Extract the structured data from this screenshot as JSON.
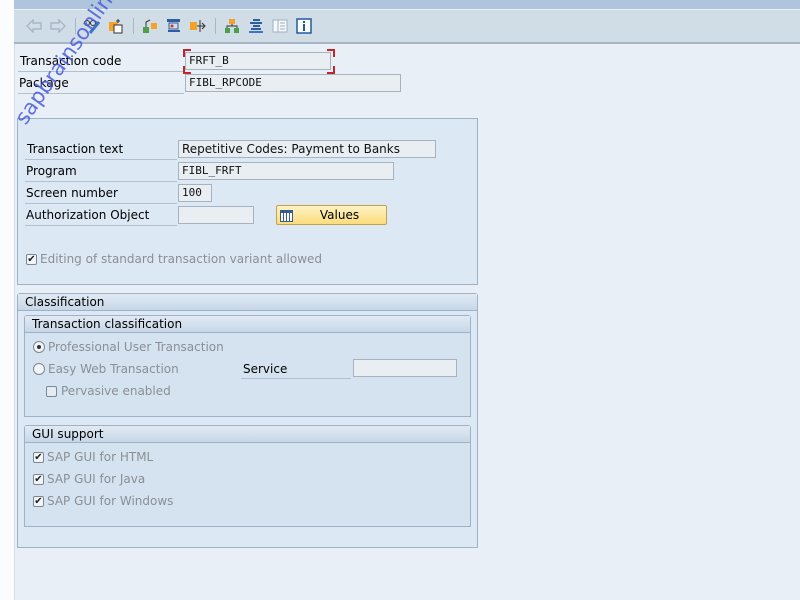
{
  "toolbar": {
    "icons": [
      "back-icon",
      "forward-icon",
      "display-change-icon",
      "other-object-icon",
      "where-used-icon",
      "display-object-list-icon",
      "navigate-icon",
      "hierarchy-icon",
      "text-align-icon",
      "layout-icon",
      "info-icon"
    ]
  },
  "header_fields": {
    "transaction_code": {
      "label": "Transaction code",
      "value": "FRFT_B"
    },
    "package": {
      "label": "Package",
      "value": "FIBL_RPCODE"
    }
  },
  "details": {
    "transaction_text": {
      "label": "Transaction text",
      "value": "Repetitive Codes: Payment to Banks"
    },
    "program": {
      "label": "Program",
      "value": "FIBL_FRFT"
    },
    "screen_number": {
      "label": "Screen number",
      "value": "100"
    },
    "authorization_object": {
      "label": "Authorization Object",
      "value": ""
    },
    "values_button": "Values",
    "editing_checkbox": {
      "label": "Editing of standard transaction variant allowed",
      "checked": true
    }
  },
  "classification": {
    "title": "Classification",
    "transaction_classification": {
      "title": "Transaction classification",
      "options": [
        {
          "label": "Professional User Transaction",
          "selected": true
        },
        {
          "label": "Easy Web Transaction",
          "selected": false
        }
      ],
      "service_label": "Service",
      "service_value": "",
      "pervasive": {
        "label": "Pervasive enabled",
        "checked": false
      }
    },
    "gui_support": {
      "title": "GUI support",
      "items": [
        {
          "label": "SAP GUI for HTML",
          "checked": true
        },
        {
          "label": "SAP GUI for Java",
          "checked": true
        },
        {
          "label": "SAP GUI for Windows",
          "checked": true
        }
      ]
    }
  },
  "watermark": "sapbrainsonline.com"
}
